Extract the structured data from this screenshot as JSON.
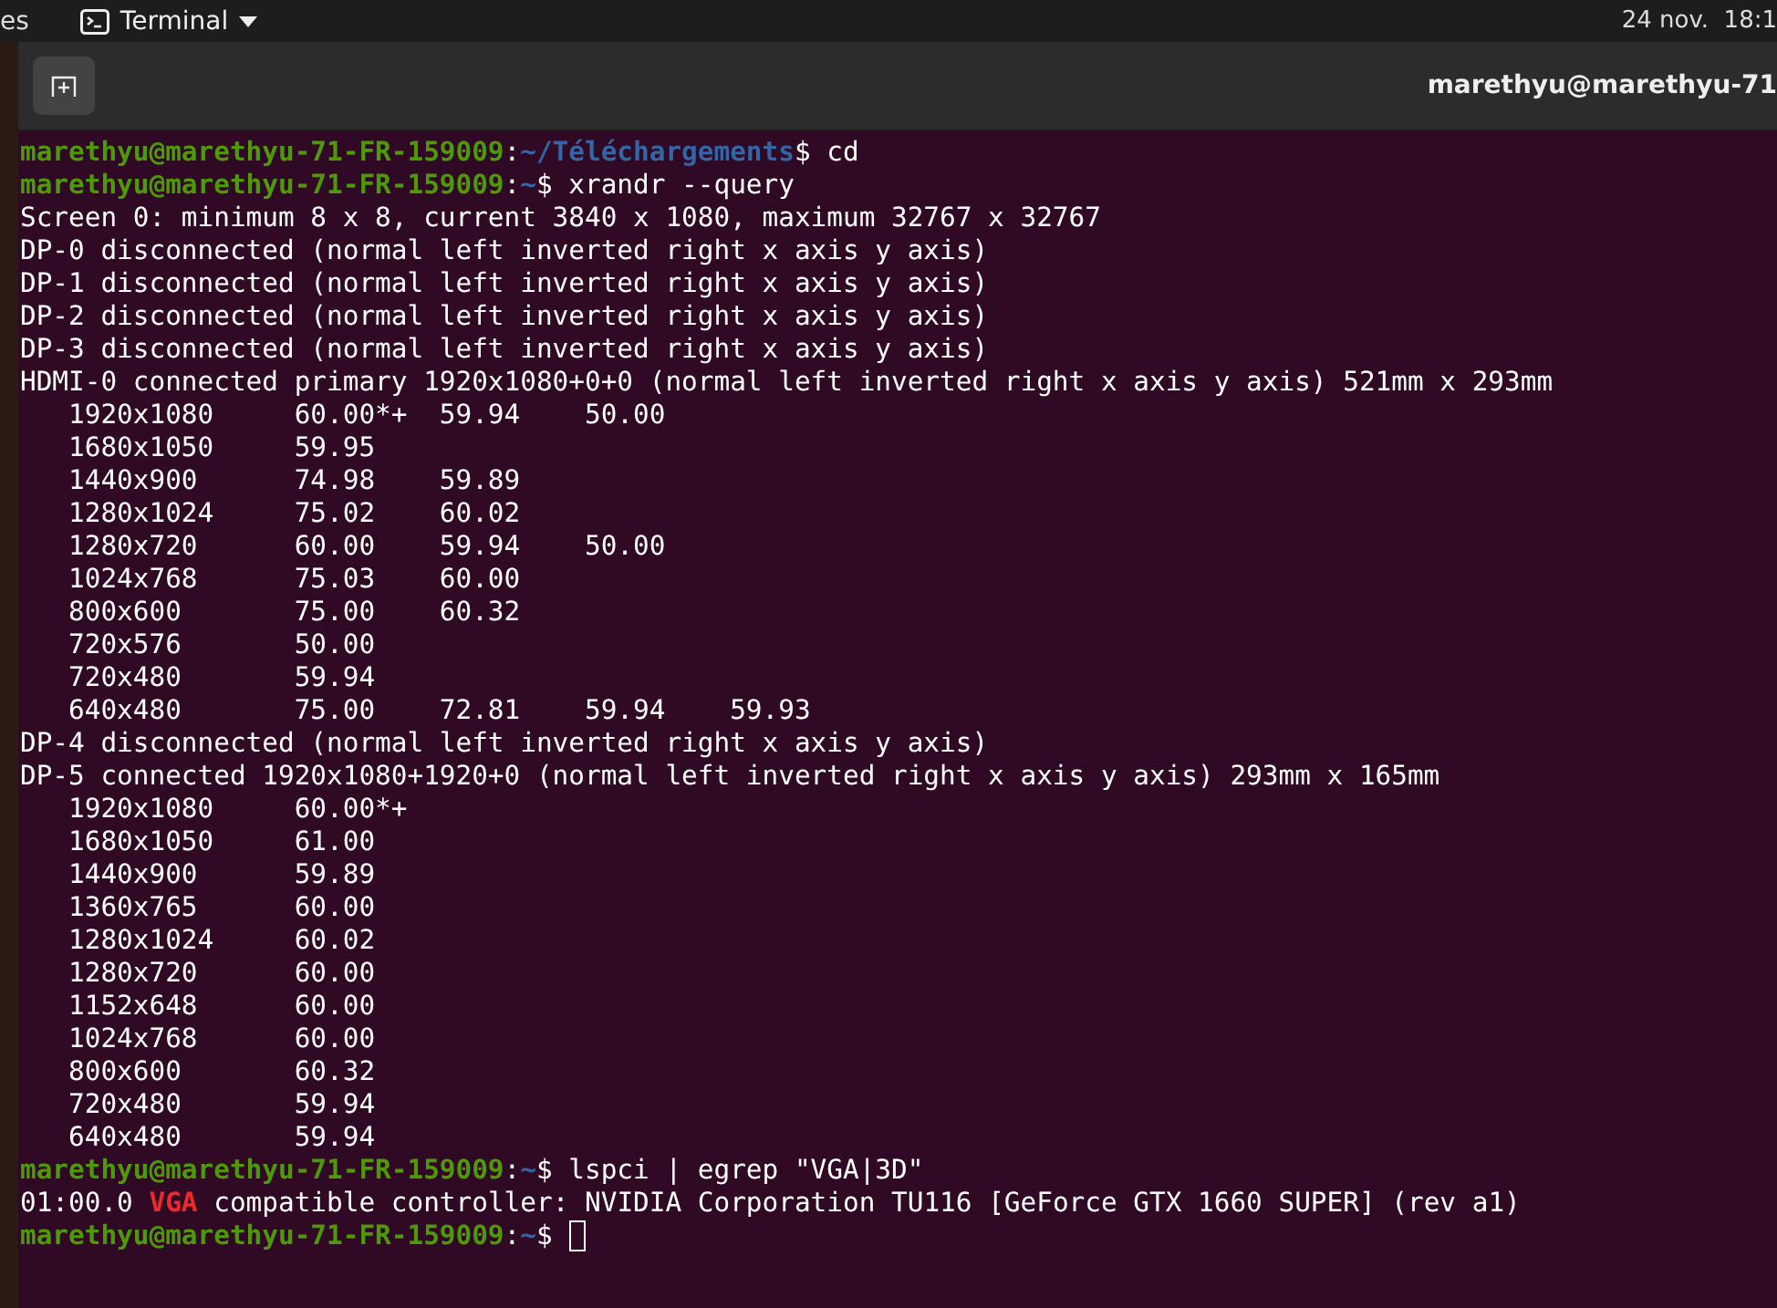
{
  "top_bar": {
    "left_fragment": "es",
    "app_menu": "Terminal",
    "clock": "24 nov.  18:1"
  },
  "window": {
    "title": "marethyu@marethyu-71"
  },
  "lines": [
    {
      "kind": "prompt",
      "user": "marethyu@marethyu-71-FR-159009",
      "separator": ":",
      "path": "~/Téléchargements",
      "sigil": "$",
      "command": "cd"
    },
    {
      "kind": "prompt",
      "user": "marethyu@marethyu-71-FR-159009",
      "separator": ":",
      "path": "~",
      "sigil": "$",
      "command": "xrandr --query"
    },
    {
      "kind": "output",
      "text": "Screen 0: minimum 8 x 8, current 3840 x 1080, maximum 32767 x 32767"
    },
    {
      "kind": "output",
      "text": "DP-0 disconnected (normal left inverted right x axis y axis)"
    },
    {
      "kind": "output",
      "text": "DP-1 disconnected (normal left inverted right x axis y axis)"
    },
    {
      "kind": "output",
      "text": "DP-2 disconnected (normal left inverted right x axis y axis)"
    },
    {
      "kind": "output",
      "text": "DP-3 disconnected (normal left inverted right x axis y axis)"
    },
    {
      "kind": "output",
      "text": "HDMI-0 connected primary 1920x1080+0+0 (normal left inverted right x axis y axis) 521mm x 293mm"
    },
    {
      "kind": "output",
      "text": "   1920x1080     60.00*+  59.94    50.00"
    },
    {
      "kind": "output",
      "text": "   1680x1050     59.95"
    },
    {
      "kind": "output",
      "text": "   1440x900      74.98    59.89"
    },
    {
      "kind": "output",
      "text": "   1280x1024     75.02    60.02"
    },
    {
      "kind": "output",
      "text": "   1280x720      60.00    59.94    50.00"
    },
    {
      "kind": "output",
      "text": "   1024x768      75.03    60.00"
    },
    {
      "kind": "output",
      "text": "   800x600       75.00    60.32"
    },
    {
      "kind": "output",
      "text": "   720x576       50.00"
    },
    {
      "kind": "output",
      "text": "   720x480       59.94"
    },
    {
      "kind": "output",
      "text": "   640x480       75.00    72.81    59.94    59.93"
    },
    {
      "kind": "output",
      "text": "DP-4 disconnected (normal left inverted right x axis y axis)"
    },
    {
      "kind": "output",
      "text": "DP-5 connected 1920x1080+1920+0 (normal left inverted right x axis y axis) 293mm x 165mm"
    },
    {
      "kind": "output",
      "text": "   1920x1080     60.00*+"
    },
    {
      "kind": "output",
      "text": "   1680x1050     61.00"
    },
    {
      "kind": "output",
      "text": "   1440x900      59.89"
    },
    {
      "kind": "output",
      "text": "   1360x765      60.00"
    },
    {
      "kind": "output",
      "text": "   1280x1024     60.02"
    },
    {
      "kind": "output",
      "text": "   1280x720      60.00"
    },
    {
      "kind": "output",
      "text": "   1152x648      60.00"
    },
    {
      "kind": "output",
      "text": "   1024x768      60.00"
    },
    {
      "kind": "output",
      "text": "   800x600       60.32"
    },
    {
      "kind": "output",
      "text": "   720x480       59.94"
    },
    {
      "kind": "output",
      "text": "   640x480       59.94"
    },
    {
      "kind": "prompt",
      "user": "marethyu@marethyu-71-FR-159009",
      "separator": ":",
      "path": "~",
      "sigil": "$",
      "command": "lspci | egrep \"VGA|3D\""
    },
    {
      "kind": "match",
      "before": "01:00.0 ",
      "match": "VGA",
      "after": " compatible controller: NVIDIA Corporation TU116 [GeForce GTX 1660 SUPER] (rev a1)"
    },
    {
      "kind": "cursor",
      "user": "marethyu@marethyu-71-FR-159009",
      "separator": ":",
      "path": "~",
      "sigil": "$"
    }
  ]
}
